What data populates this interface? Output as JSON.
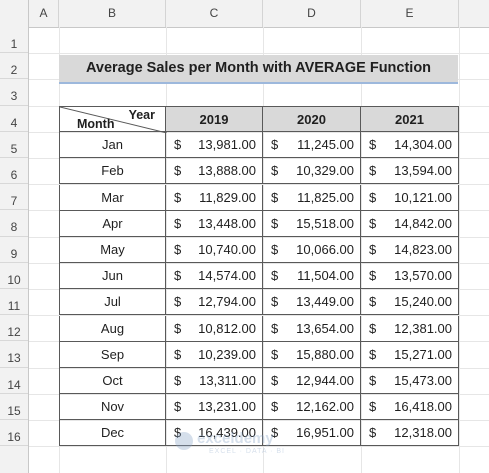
{
  "sheet": {
    "columns": [
      "A",
      "B",
      "C",
      "D",
      "E"
    ],
    "rows": [
      "1",
      "2",
      "3",
      "4",
      "5",
      "6",
      "7",
      "8",
      "9",
      "10",
      "11",
      "12",
      "13",
      "14",
      "15",
      "16"
    ]
  },
  "title": "Average Sales per Month with AVERAGE Function",
  "table": {
    "corner_top": "Year",
    "corner_bottom": "Month",
    "years": [
      "2019",
      "2020",
      "2021"
    ],
    "currency": "$",
    "rows": [
      {
        "month": "Jan",
        "values": [
          "13,981.00",
          "11,245.00",
          "14,304.00"
        ]
      },
      {
        "month": "Feb",
        "values": [
          "13,888.00",
          "10,329.00",
          "13,594.00"
        ]
      },
      {
        "month": "Mar",
        "values": [
          "11,829.00",
          "11,825.00",
          "10,121.00"
        ]
      },
      {
        "month": "Apr",
        "values": [
          "13,448.00",
          "15,518.00",
          "14,842.00"
        ]
      },
      {
        "month": "May",
        "values": [
          "10,740.00",
          "10,066.00",
          "14,823.00"
        ]
      },
      {
        "month": "Jun",
        "values": [
          "14,574.00",
          "11,504.00",
          "13,570.00"
        ]
      },
      {
        "month": "Jul",
        "values": [
          "12,794.00",
          "13,449.00",
          "15,240.00"
        ]
      },
      {
        "month": "Aug",
        "values": [
          "10,812.00",
          "13,654.00",
          "12,381.00"
        ]
      },
      {
        "month": "Sep",
        "values": [
          "10,239.00",
          "15,880.00",
          "15,271.00"
        ]
      },
      {
        "month": "Oct",
        "values": [
          "13,311.00",
          "12,944.00",
          "15,473.00"
        ]
      },
      {
        "month": "Nov",
        "values": [
          "13,231.00",
          "12,162.00",
          "16,418.00"
        ]
      },
      {
        "month": "Dec",
        "values": [
          "16,439.00",
          "16,951.00",
          "12,318.00"
        ]
      }
    ]
  },
  "watermark": {
    "name": "exceldemy",
    "tagline": "EXCEL · DATA · BI"
  }
}
